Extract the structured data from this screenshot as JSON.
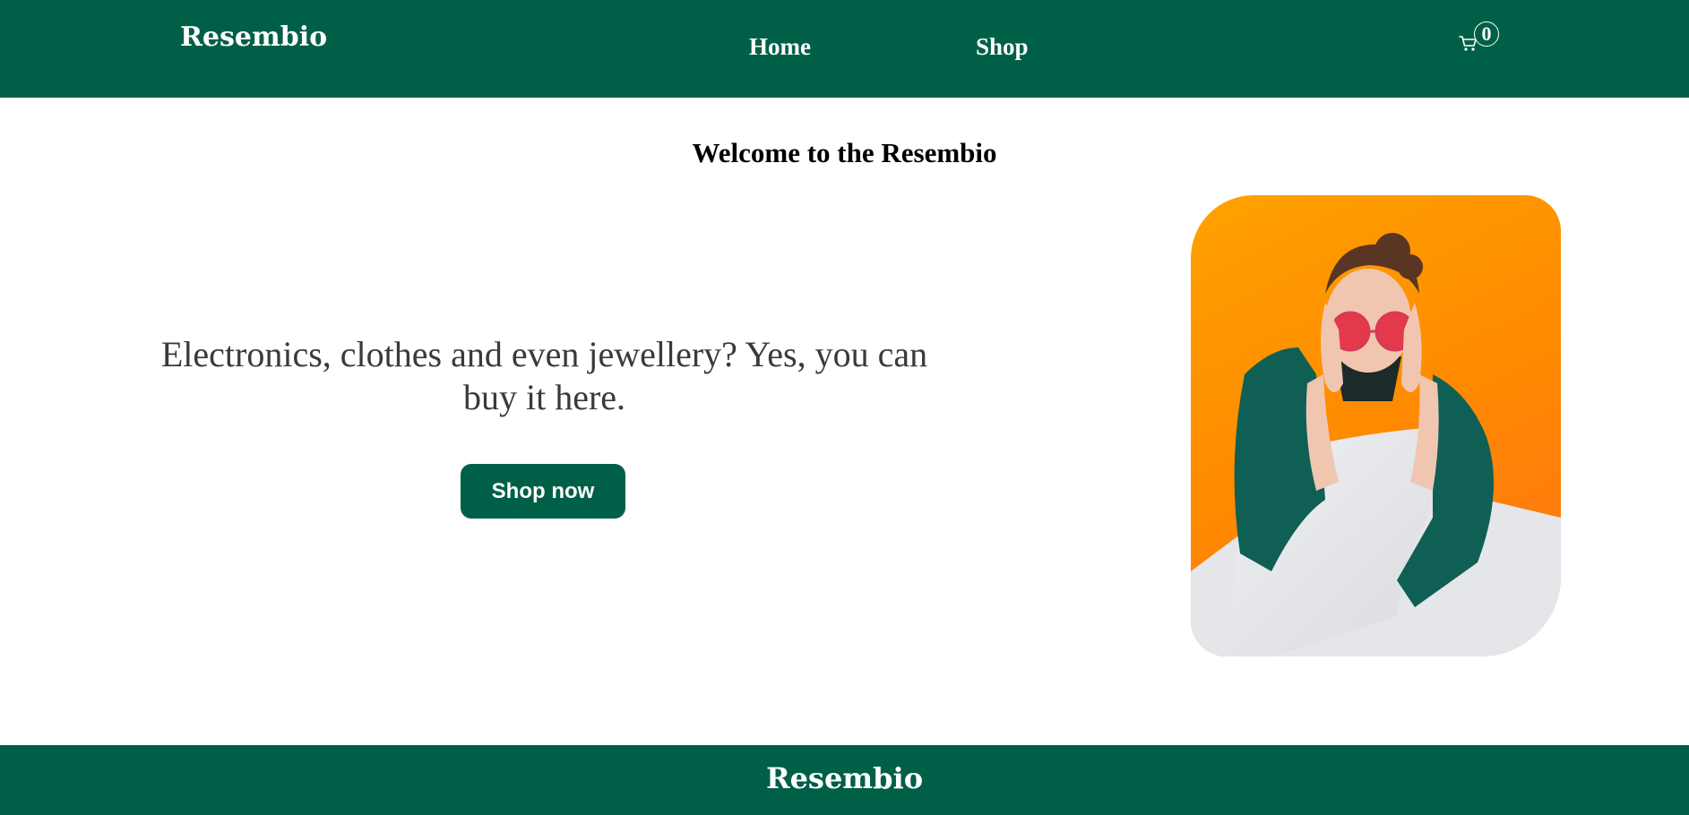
{
  "header": {
    "brand": "Resembio",
    "nav": {
      "home": "Home",
      "shop": "Shop"
    },
    "cart": {
      "icon": "cart-icon",
      "count": "0"
    }
  },
  "hero": {
    "welcome": "Welcome to the Resembio",
    "tagline": "Electronics, clothes and even jewellery? Yes, you can buy it here.",
    "cta_label": "Shop now",
    "image_description": "woman-orange-background-red-sunglasses"
  },
  "footer": {
    "brand": "Resembio"
  },
  "colors": {
    "primary": "#006047",
    "background": "#ffffff",
    "tagline_text": "#3a3a3a",
    "hero_orange": "#ff8a00"
  }
}
